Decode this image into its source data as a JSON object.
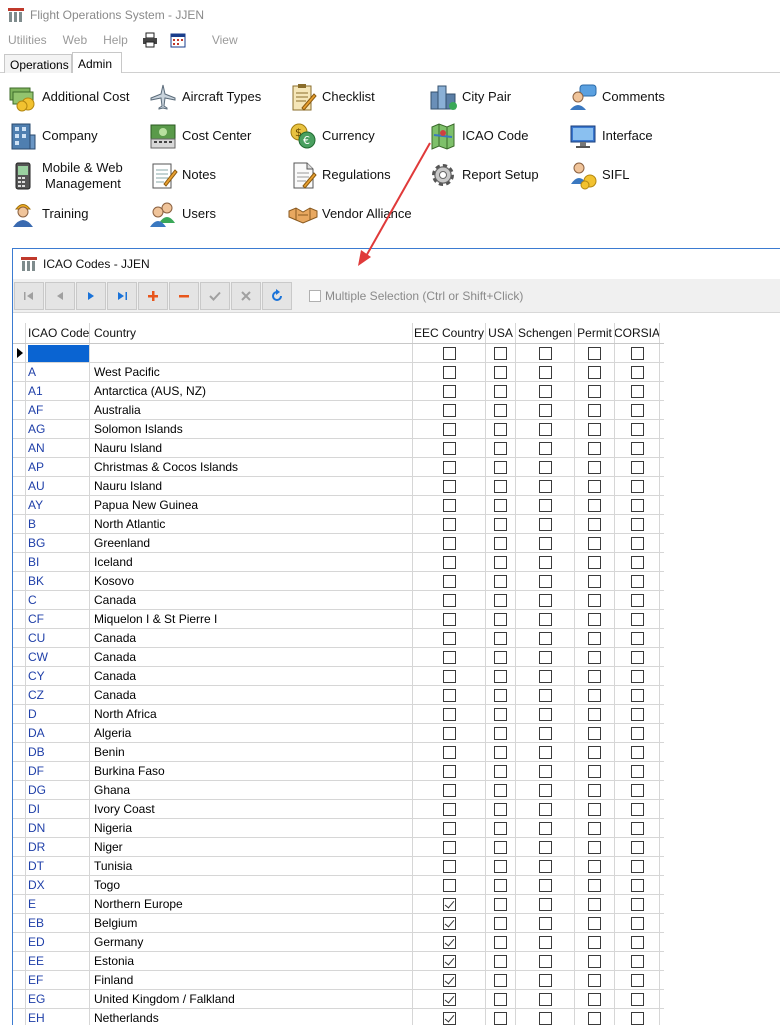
{
  "app": {
    "title": "Flight Operations System - JJEN"
  },
  "menu": {
    "items": [
      "Utilities",
      "Web",
      "Help"
    ],
    "view_label": "View"
  },
  "tabs": [
    {
      "label": "Operations",
      "active": false
    },
    {
      "label": "Admin",
      "active": true
    }
  ],
  "ribbon": {
    "items": [
      {
        "label": "Additional Cost",
        "icon": "money-icon"
      },
      {
        "label": "Aircraft Types",
        "icon": "airplane-icon"
      },
      {
        "label": "Checklist",
        "icon": "checklist-icon"
      },
      {
        "label": "City Pair",
        "icon": "city-icon"
      },
      {
        "label": "Comments",
        "icon": "comment-user-icon"
      },
      {
        "label": "Company",
        "icon": "building-icon"
      },
      {
        "label": "Cost Center",
        "icon": "cash-register-icon"
      },
      {
        "label": "Currency",
        "icon": "currency-exchange-icon"
      },
      {
        "label": "ICAO Code",
        "icon": "map-icon"
      },
      {
        "label": "Interface",
        "icon": "monitor-icon"
      },
      {
        "label": "Mobile & Web\nManagement",
        "line1": "Mobile & Web",
        "line2": "Management",
        "icon": "mobile-phone-icon"
      },
      {
        "label": "Notes",
        "icon": "notepad-icon"
      },
      {
        "label": "Regulations",
        "icon": "document-icon"
      },
      {
        "label": "Report Setup",
        "icon": "gear-icon"
      },
      {
        "label": "SIFL",
        "icon": "user-money-icon"
      },
      {
        "label": "Training",
        "icon": "worker-icon"
      },
      {
        "label": "Users",
        "icon": "users-icon"
      },
      {
        "label": "Vendor Alliance",
        "icon": "handshake-icon"
      }
    ]
  },
  "child_window": {
    "title": "ICAO Codes - JJEN",
    "toolbar": {
      "buttons": [
        "first-record",
        "previous-record",
        "next-record",
        "last-record",
        "add-record",
        "delete-record",
        "post-edit",
        "cancel-edit",
        "refresh"
      ],
      "multiple_selection_label": "Multiple Selection (Ctrl or Shift+Click)",
      "multiple_selection_checked": false
    },
    "grid": {
      "columns": [
        "ICAO Code",
        "Country",
        "EEC Country",
        "USA",
        "Schengen",
        "Permit",
        "CORSIA"
      ],
      "rows": [
        {
          "code": "",
          "country": "",
          "eec": false,
          "usa": false,
          "schengen": false,
          "permit": false,
          "corsia": false,
          "editing": true
        },
        {
          "code": "A",
          "country": "West Pacific",
          "eec": false,
          "usa": false,
          "schengen": false,
          "permit": false,
          "corsia": false
        },
        {
          "code": "A1",
          "country": "Antarctica (AUS, NZ)",
          "eec": false,
          "usa": false,
          "schengen": false,
          "permit": false,
          "corsia": false
        },
        {
          "code": "AF",
          "country": "Australia",
          "eec": false,
          "usa": false,
          "schengen": false,
          "permit": false,
          "corsia": false
        },
        {
          "code": "AG",
          "country": "Solomon Islands",
          "eec": false,
          "usa": false,
          "schengen": false,
          "permit": false,
          "corsia": false
        },
        {
          "code": "AN",
          "country": "Nauru Island",
          "eec": false,
          "usa": false,
          "schengen": false,
          "permit": false,
          "corsia": false
        },
        {
          "code": "AP",
          "country": "Christmas & Cocos Islands",
          "eec": false,
          "usa": false,
          "schengen": false,
          "permit": false,
          "corsia": false
        },
        {
          "code": "AU",
          "country": "Nauru Island",
          "eec": false,
          "usa": false,
          "schengen": false,
          "permit": false,
          "corsia": false
        },
        {
          "code": "AY",
          "country": "Papua New Guinea",
          "eec": false,
          "usa": false,
          "schengen": false,
          "permit": false,
          "corsia": false
        },
        {
          "code": "B",
          "country": "North Atlantic",
          "eec": false,
          "usa": false,
          "schengen": false,
          "permit": false,
          "corsia": false
        },
        {
          "code": "BG",
          "country": "Greenland",
          "eec": false,
          "usa": false,
          "schengen": false,
          "permit": false,
          "corsia": false
        },
        {
          "code": "BI",
          "country": "Iceland",
          "eec": false,
          "usa": false,
          "schengen": false,
          "permit": false,
          "corsia": false
        },
        {
          "code": "BK",
          "country": "Kosovo",
          "eec": false,
          "usa": false,
          "schengen": false,
          "permit": false,
          "corsia": false
        },
        {
          "code": "C",
          "country": "Canada",
          "eec": false,
          "usa": false,
          "schengen": false,
          "permit": false,
          "corsia": false
        },
        {
          "code": "CF",
          "country": "Miquelon I & St Pierre I",
          "eec": false,
          "usa": false,
          "schengen": false,
          "permit": false,
          "corsia": false
        },
        {
          "code": "CU",
          "country": "Canada",
          "eec": false,
          "usa": false,
          "schengen": false,
          "permit": false,
          "corsia": false
        },
        {
          "code": "CW",
          "country": "Canada",
          "eec": false,
          "usa": false,
          "schengen": false,
          "permit": false,
          "corsia": false
        },
        {
          "code": "CY",
          "country": "Canada",
          "eec": false,
          "usa": false,
          "schengen": false,
          "permit": false,
          "corsia": false
        },
        {
          "code": "CZ",
          "country": "Canada",
          "eec": false,
          "usa": false,
          "schengen": false,
          "permit": false,
          "corsia": false
        },
        {
          "code": "D",
          "country": "North Africa",
          "eec": false,
          "usa": false,
          "schengen": false,
          "permit": false,
          "corsia": false
        },
        {
          "code": "DA",
          "country": "Algeria",
          "eec": false,
          "usa": false,
          "schengen": false,
          "permit": false,
          "corsia": false
        },
        {
          "code": "DB",
          "country": "Benin",
          "eec": false,
          "usa": false,
          "schengen": false,
          "permit": false,
          "corsia": false
        },
        {
          "code": "DF",
          "country": "Burkina Faso",
          "eec": false,
          "usa": false,
          "schengen": false,
          "permit": false,
          "corsia": false
        },
        {
          "code": "DG",
          "country": "Ghana",
          "eec": false,
          "usa": false,
          "schengen": false,
          "permit": false,
          "corsia": false
        },
        {
          "code": "DI",
          "country": "Ivory Coast",
          "eec": false,
          "usa": false,
          "schengen": false,
          "permit": false,
          "corsia": false
        },
        {
          "code": "DN",
          "country": "Nigeria",
          "eec": false,
          "usa": false,
          "schengen": false,
          "permit": false,
          "corsia": false
        },
        {
          "code": "DR",
          "country": "Niger",
          "eec": false,
          "usa": false,
          "schengen": false,
          "permit": false,
          "corsia": false
        },
        {
          "code": "DT",
          "country": "Tunisia",
          "eec": false,
          "usa": false,
          "schengen": false,
          "permit": false,
          "corsia": false
        },
        {
          "code": "DX",
          "country": "Togo",
          "eec": false,
          "usa": false,
          "schengen": false,
          "permit": false,
          "corsia": false
        },
        {
          "code": "E",
          "country": "Northern Europe",
          "eec": true,
          "usa": false,
          "schengen": false,
          "permit": false,
          "corsia": false
        },
        {
          "code": "EB",
          "country": "Belgium",
          "eec": true,
          "usa": false,
          "schengen": false,
          "permit": false,
          "corsia": false
        },
        {
          "code": "ED",
          "country": "Germany",
          "eec": true,
          "usa": false,
          "schengen": false,
          "permit": false,
          "corsia": false
        },
        {
          "code": "EE",
          "country": "Estonia",
          "eec": true,
          "usa": false,
          "schengen": false,
          "permit": false,
          "corsia": false
        },
        {
          "code": "EF",
          "country": "Finland",
          "eec": true,
          "usa": false,
          "schengen": false,
          "permit": false,
          "corsia": false
        },
        {
          "code": "EG",
          "country": "United Kingdom / Falkland",
          "eec": true,
          "usa": false,
          "schengen": false,
          "permit": false,
          "corsia": false
        },
        {
          "code": "EH",
          "country": "Netherlands",
          "eec": true,
          "usa": false,
          "schengen": false,
          "permit": false,
          "corsia": false
        }
      ]
    }
  },
  "colors": {
    "accent": "#0a64d2",
    "code_text": "#1f3fa8",
    "arrow": "#e03a3a",
    "add": "#e8561c",
    "nav": "#1a73d9"
  }
}
